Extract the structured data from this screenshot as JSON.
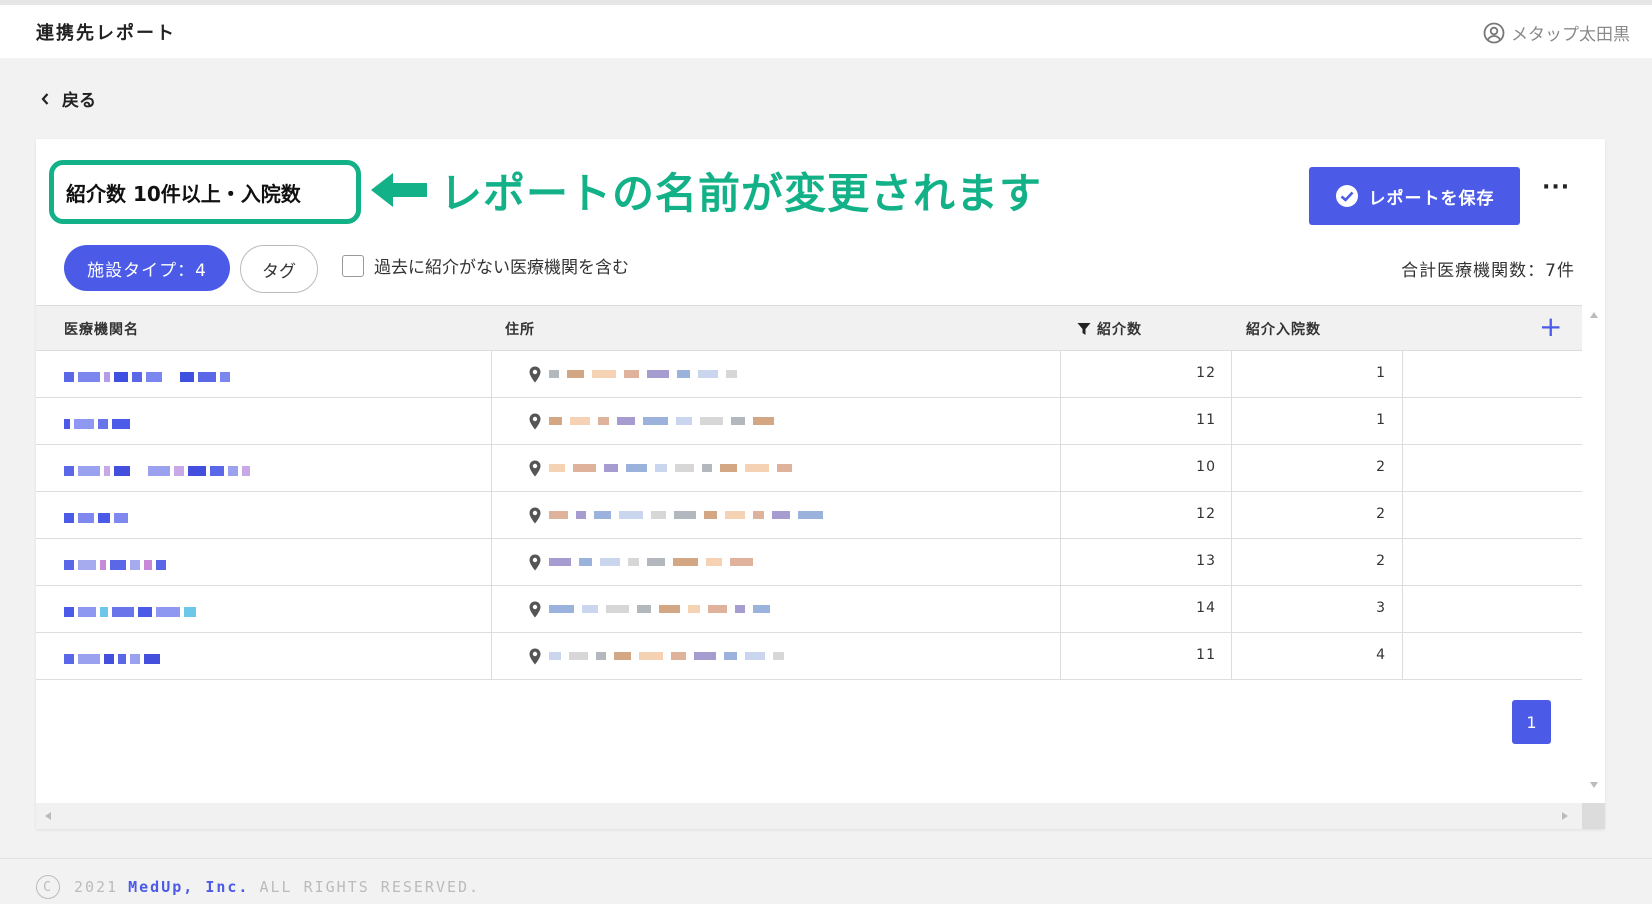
{
  "header": {
    "app_title": "連携先レポート",
    "user_name": "メタップ太田黒"
  },
  "nav": {
    "back_label": "戻る"
  },
  "report": {
    "name": "紹介数 10件以上・入院数",
    "annotation": "レポートの名前が変更されます",
    "save_label": "レポートを保存",
    "more_label": "···"
  },
  "filters": {
    "facility_type_label": "施設タイプ：4",
    "tag_label": "タグ",
    "include_no_referral_label": "過去に紹介がない医療機関を含む",
    "total_label": "合計医療機関数：7件"
  },
  "table": {
    "columns": {
      "name": "医療機関名",
      "address": "住所",
      "referrals": "紹介数",
      "admissions": "紹介入院数"
    },
    "rows": [
      {
        "referrals": "12",
        "admissions": "1"
      },
      {
        "referrals": "11",
        "admissions": "1"
      },
      {
        "referrals": "10",
        "admissions": "2"
      },
      {
        "referrals": "12",
        "admissions": "2"
      },
      {
        "referrals": "13",
        "admissions": "2"
      },
      {
        "referrals": "14",
        "admissions": "3"
      },
      {
        "referrals": "11",
        "admissions": "4"
      }
    ]
  },
  "pagination": {
    "current_page": "1"
  },
  "footer": {
    "copyright": "2021",
    "brand": "MedUp, Inc.",
    "rights": "ALL RIGHTS RESERVED."
  },
  "colors": {
    "accent": "#4b5be8",
    "annotation": "#12b187"
  }
}
